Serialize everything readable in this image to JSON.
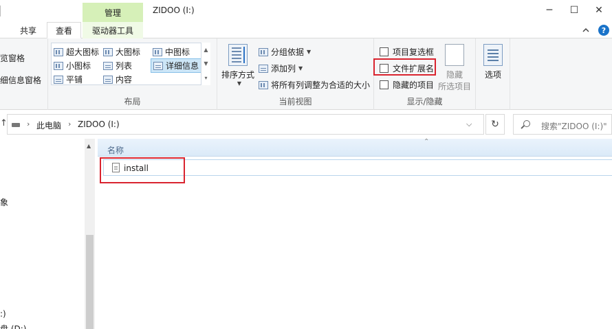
{
  "titlebar": {
    "manage_tab": "管理",
    "window_title": "ZIDOO (I:)",
    "minimize": "─",
    "maximize": "☐",
    "close": "✕"
  },
  "ribbon_tabs": {
    "share": "共享",
    "view": "查看",
    "drive_tools": "驱动器工具"
  },
  "ribbon": {
    "pane_group": {
      "preview_pane": "览窗格",
      "details_pane": "细信息窗格"
    },
    "layout_group": {
      "label": "布局",
      "extra_large_icons": "超大图标",
      "large_icons": "大图标",
      "medium_icons": "中图标",
      "small_icons": "小图标",
      "list": "列表",
      "details": "详细信息",
      "tiles": "平铺",
      "content": "内容"
    },
    "current_view_group": {
      "label": "当前视图",
      "sort_by": "排序方式",
      "group_by": "分组依据",
      "add_columns": "添加列",
      "size_all_columns": "将所有列调整为合适的大小"
    },
    "show_hide_group": {
      "label": "显示/隐藏",
      "item_checkboxes": "项目复选框",
      "file_name_extensions": "文件扩展名",
      "hidden_items": "隐藏的项目",
      "hide": "隐藏",
      "selected_items": "所选项目"
    },
    "options": "选项"
  },
  "address": {
    "crumb_this_pc": "此电脑",
    "crumb_drive": "ZIDOO (I:)",
    "sep": "›",
    "dropdown": "⌵",
    "refresh": "↻",
    "search_placeholder": "搜索\"ZIDOO (I:)\""
  },
  "nav_pane": {
    "frag_1": "象",
    "frag_2": ":)",
    "frag_3": "盘 (D:)"
  },
  "file_list": {
    "column_name": "名称",
    "files": [
      "install"
    ]
  }
}
